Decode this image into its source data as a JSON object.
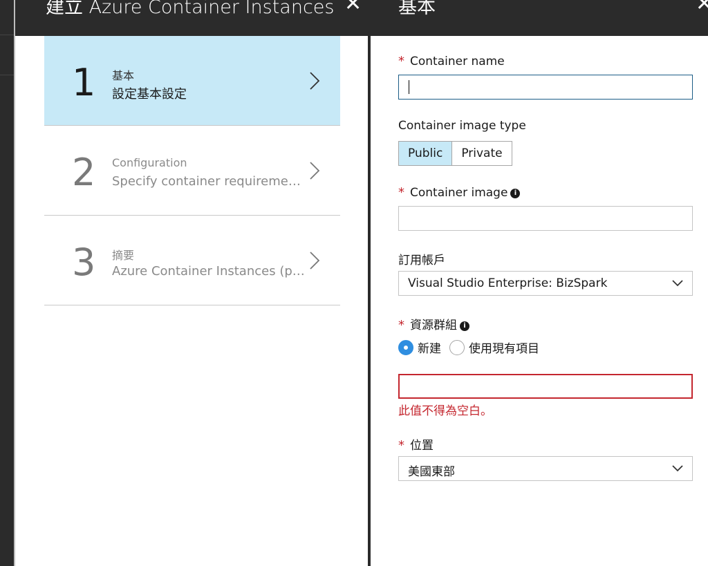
{
  "blade1": {
    "title": "建立 Azure Container Instances ...",
    "close": "✕",
    "steps": [
      {
        "number": "1",
        "title": "基本",
        "subtitle": "設定基本設定"
      },
      {
        "number": "2",
        "title": "Configuration",
        "subtitle": "Specify container requirements"
      },
      {
        "number": "3",
        "title": "摘要",
        "subtitle": "Azure Container Instances (pre..."
      }
    ]
  },
  "blade2": {
    "title": "基本",
    "close": "✕",
    "required_marker": "*",
    "info_marker": "i",
    "container_name": {
      "label": "Container name",
      "value": ""
    },
    "image_type": {
      "label": "Container image type",
      "options": [
        "Public",
        "Private"
      ],
      "selected": "Public"
    },
    "container_image": {
      "label": "Container image",
      "value": ""
    },
    "subscription": {
      "label": "訂用帳戶",
      "value": "Visual Studio Enterprise: BizSpark"
    },
    "resource_group": {
      "label": "資源群組",
      "options": [
        "新建",
        "使用現有項目"
      ],
      "selected": "新建",
      "value": "",
      "error": "此值不得為空白。"
    },
    "location": {
      "label": "位置",
      "value": "美國東部"
    }
  },
  "colors": {
    "accent": "#c7e9f7",
    "error": "#c4262e",
    "radio": "#2f8ee0",
    "dark": "#2b2b2b"
  }
}
